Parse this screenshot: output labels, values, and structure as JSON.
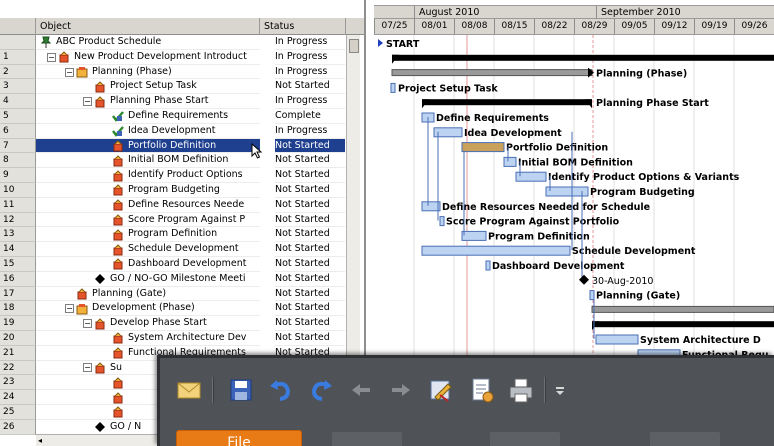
{
  "grid": {
    "header": {
      "object": "Object",
      "status": "Status"
    },
    "rows": [
      {
        "num": "",
        "label": "ABC Product Schedule",
        "status": "In Progress",
        "icon": "pushpin-icon",
        "indent": 0,
        "expander": ""
      },
      {
        "num": "1",
        "label": "New Product Development Introduct",
        "status": "In Progress",
        "icon": "task-icon",
        "indent": 1,
        "expander": "−"
      },
      {
        "num": "2",
        "label": "Planning  (Phase)",
        "status": "In Progress",
        "icon": "phase-icon",
        "indent": 2,
        "expander": "−"
      },
      {
        "num": "3",
        "label": "Project Setup Task",
        "status": "Not Started",
        "icon": "task-icon",
        "indent": 3,
        "expander": ""
      },
      {
        "num": "4",
        "label": "Planning Phase Start",
        "status": "In Progress",
        "icon": "task-icon",
        "indent": 3,
        "expander": "−"
      },
      {
        "num": "5",
        "label": "Define Requirements",
        "status": "Complete",
        "icon": "checked-task-icon",
        "indent": 4,
        "expander": ""
      },
      {
        "num": "6",
        "label": "Idea Development",
        "status": "In Progress",
        "icon": "checked-task-icon",
        "indent": 4,
        "expander": ""
      },
      {
        "num": "7",
        "label": "Portfolio Definition",
        "status": "Not Started",
        "icon": "task-icon",
        "indent": 4,
        "expander": ""
      },
      {
        "num": "8",
        "label": "Initial BOM Definition",
        "status": "Not Started",
        "icon": "task-icon",
        "indent": 4,
        "expander": ""
      },
      {
        "num": "9",
        "label": "Identify Product Options",
        "status": "Not Started",
        "icon": "task-icon",
        "indent": 4,
        "expander": ""
      },
      {
        "num": "10",
        "label": "Program Budgeting",
        "status": "Not Started",
        "icon": "task-icon",
        "indent": 4,
        "expander": ""
      },
      {
        "num": "11",
        "label": "Define Resources Neede",
        "status": "Not Started",
        "icon": "task-icon",
        "indent": 4,
        "expander": ""
      },
      {
        "num": "12",
        "label": "Score Program Against P",
        "status": "Not Started",
        "icon": "task-icon",
        "indent": 4,
        "expander": ""
      },
      {
        "num": "13",
        "label": "Program Definition",
        "status": "Not Started",
        "icon": "task-icon",
        "indent": 4,
        "expander": ""
      },
      {
        "num": "14",
        "label": "Schedule Development",
        "status": "Not Started",
        "icon": "task-icon",
        "indent": 4,
        "expander": ""
      },
      {
        "num": "15",
        "label": "Dashboard Development",
        "status": "Not Started",
        "icon": "task-icon",
        "indent": 4,
        "expander": ""
      },
      {
        "num": "16",
        "label": "GO / NO-GO Milestone Meeti",
        "status": "Not Started",
        "icon": "milestone-icon",
        "indent": 3,
        "expander": ""
      },
      {
        "num": "17",
        "label": "Planning  (Gate)",
        "status": "Not Started",
        "icon": "gate-icon",
        "indent": 2,
        "expander": ""
      },
      {
        "num": "18",
        "label": "Development  (Phase)",
        "status": "Not Started",
        "icon": "phase-icon",
        "indent": 2,
        "expander": "−"
      },
      {
        "num": "19",
        "label": "Develop Phase Start",
        "status": "Not Started",
        "icon": "task-icon",
        "indent": 3,
        "expander": "−"
      },
      {
        "num": "20",
        "label": "System Architecture Dev",
        "status": "Not Started",
        "icon": "task-icon",
        "indent": 4,
        "expander": ""
      },
      {
        "num": "21",
        "label": "Functional Requirements",
        "status": "Not Started",
        "icon": "task-icon",
        "indent": 4,
        "expander": ""
      },
      {
        "num": "22",
        "label": "Su",
        "status": "",
        "icon": "task-icon",
        "indent": 3,
        "expander": "−"
      },
      {
        "num": "23",
        "label": "",
        "status": "",
        "icon": "task-icon",
        "indent": 4,
        "expander": ""
      },
      {
        "num": "24",
        "label": "",
        "status": "",
        "icon": "task-icon",
        "indent": 4,
        "expander": ""
      },
      {
        "num": "25",
        "label": "",
        "status": "",
        "icon": "task-icon",
        "indent": 4,
        "expander": ""
      },
      {
        "num": "26",
        "label": "GO / N",
        "status": "",
        "icon": "milestone-icon",
        "indent": 3,
        "expander": ""
      }
    ],
    "selected_row": "7"
  },
  "gantt": {
    "months": [
      "August 2010",
      "September 2010"
    ],
    "weeks": [
      "07/25",
      "08/01",
      "08/08",
      "08/15",
      "08/22",
      "08/29",
      "09/05",
      "09/12",
      "09/19",
      "09/26"
    ],
    "start_label": "START",
    "labels": {
      "planning_phase": "Planning  (Phase)",
      "project_setup": "Project Setup Task",
      "planning_phase_start": "Planning Phase Start",
      "define_requirements": "Define Requirements",
      "idea_development": "Idea Development",
      "portfolio_definition": "Portfolio Definition",
      "initial_bom": "Initial BOM Definition",
      "identify_options": "Identify Product Options & Variants",
      "program_budgeting": "Program Budgeting",
      "define_resources": "Define Resources Needed for Schedule",
      "score_program": "Score Program Against Portfolio",
      "program_definition": "Program Definition",
      "schedule_development": "Schedule Development",
      "dashboard_development": "Dashboard Development",
      "milestone_date": "30-Aug-2010",
      "planning_gate": "Planning  (Gate)",
      "system_architecture": "System Architecture D",
      "functional_requirements": "Functional Requ"
    },
    "colors": {
      "bar_fill": "#bcd3f2",
      "bar_stroke": "#4a6fb5",
      "summary": "#000000",
      "progress": "#c9a15a",
      "milestone": "#000000"
    }
  },
  "ribbon": {
    "tabs": {
      "file": "File"
    },
    "quick_access": [
      "email-icon",
      "save-icon",
      "undo-icon",
      "redo-icon",
      "outdent-icon",
      "indent-icon",
      "edit-icon",
      "page-setup-icon",
      "print-icon",
      "customize-dropdown-icon"
    ]
  }
}
